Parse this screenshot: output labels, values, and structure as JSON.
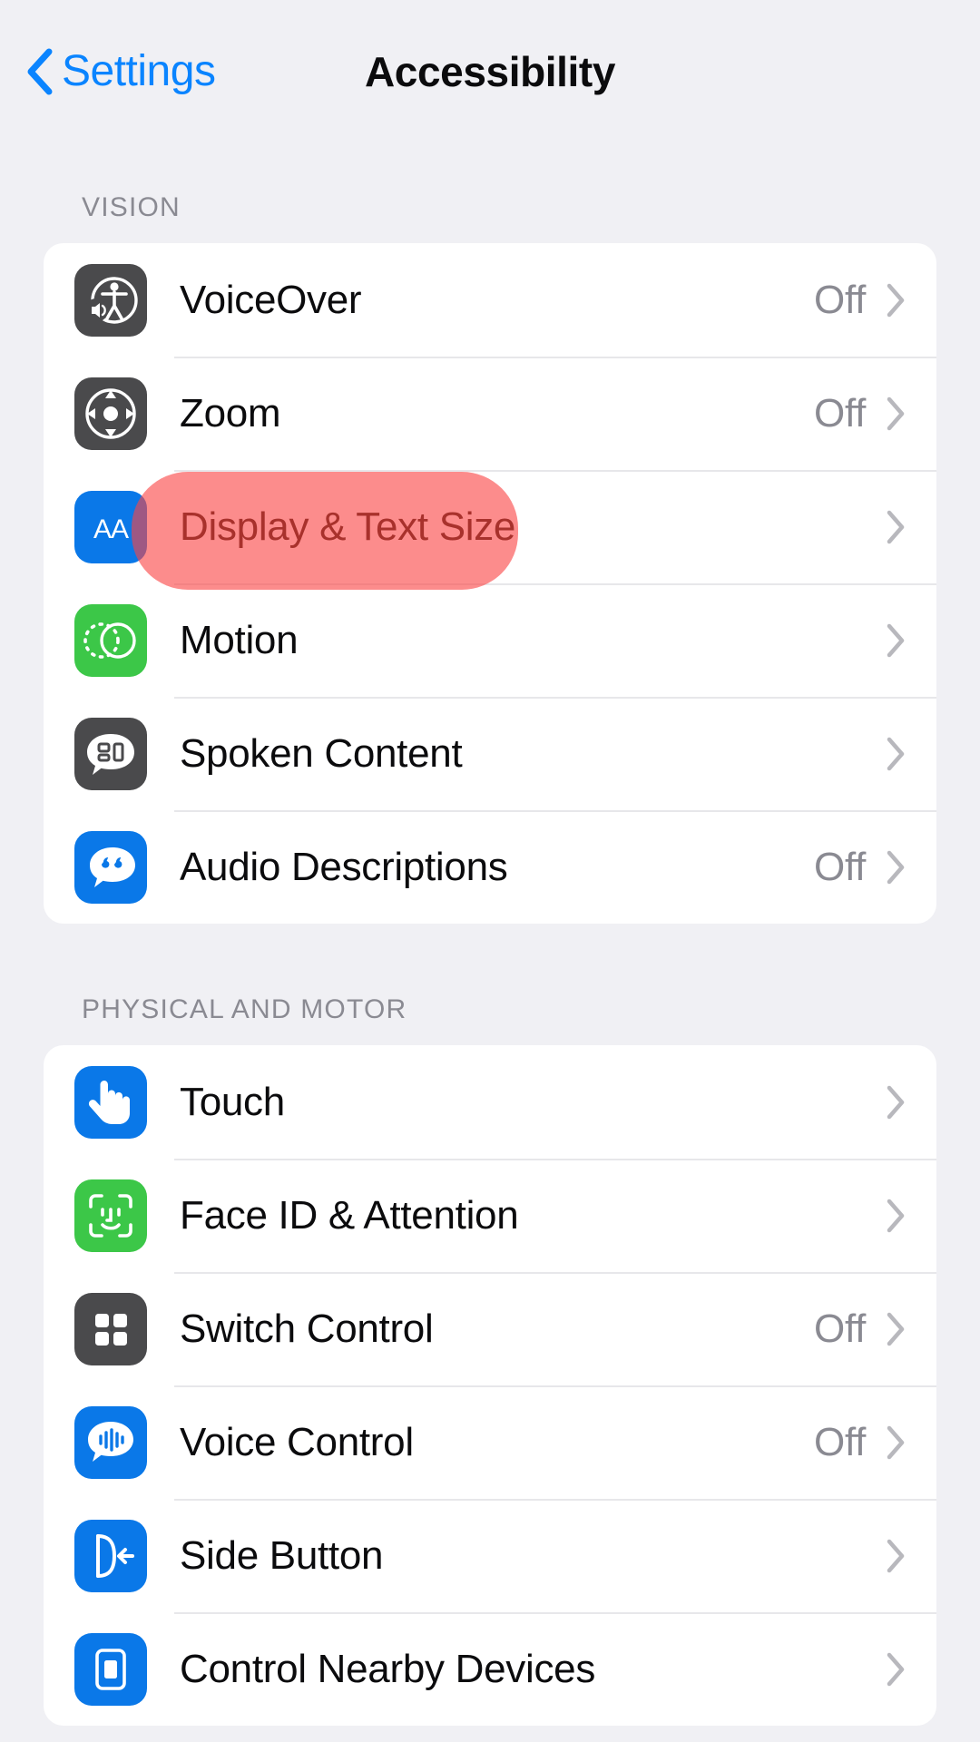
{
  "header": {
    "back_label": "Settings",
    "back_icon": "chevron-left-icon",
    "title": "Accessibility"
  },
  "accent_colors": {
    "ios_blue": "#0a84ff",
    "icon_blue": "#0a78e8",
    "icon_green": "#3cc748",
    "icon_gray": "#4a4a4c",
    "separator": "#e7e7ea",
    "page_background": "#f0f0f4",
    "card_background": "#ffffff",
    "secondary_text": "#8a8a92",
    "highlight_red": "#fa4646",
    "highlight_text_red": "#a8312c"
  },
  "highlight": {
    "target_row": "Display & Text Size",
    "shape": "rounded-rectangle",
    "color": "#fa4646"
  },
  "sections": [
    {
      "title": "VISION",
      "rows": [
        {
          "label": "VoiceOver",
          "value": "Off",
          "icon": "voiceover-icon",
          "icon_color": "gray"
        },
        {
          "label": "Zoom",
          "value": "Off",
          "icon": "zoom-icon",
          "icon_color": "gray"
        },
        {
          "label": "Display & Text Size",
          "value": "",
          "icon": "display-text-size-icon",
          "icon_color": "blue"
        },
        {
          "label": "Motion",
          "value": "",
          "icon": "motion-icon",
          "icon_color": "green"
        },
        {
          "label": "Spoken Content",
          "value": "",
          "icon": "spoken-content-icon",
          "icon_color": "gray"
        },
        {
          "label": "Audio Descriptions",
          "value": "Off",
          "icon": "audio-descriptions-icon",
          "icon_color": "blue"
        }
      ]
    },
    {
      "title": "PHYSICAL AND MOTOR",
      "rows": [
        {
          "label": "Touch",
          "value": "",
          "icon": "touch-icon",
          "icon_color": "blue"
        },
        {
          "label": "Face ID & Attention",
          "value": "",
          "icon": "face-id-icon",
          "icon_color": "green"
        },
        {
          "label": "Switch Control",
          "value": "Off",
          "icon": "switch-control-icon",
          "icon_color": "gray"
        },
        {
          "label": "Voice Control",
          "value": "Off",
          "icon": "voice-control-icon",
          "icon_color": "blue"
        },
        {
          "label": "Side Button",
          "value": "",
          "icon": "side-button-icon",
          "icon_color": "blue"
        },
        {
          "label": "Control Nearby Devices",
          "value": "",
          "icon": "control-nearby-devices-icon",
          "icon_color": "blue"
        }
      ]
    }
  ]
}
